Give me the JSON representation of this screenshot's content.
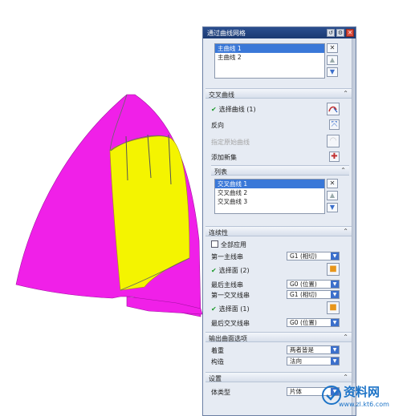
{
  "dialog": {
    "title": "通过曲线网格",
    "title_buttons": [
      "reset-icon",
      "gear-icon",
      "close-icon"
    ],
    "primary_list": {
      "items": [
        {
          "label": "主曲线 1",
          "selected": true
        },
        {
          "label": "主曲线 2",
          "selected": false
        }
      ]
    },
    "cross_section": {
      "header": "交叉曲线",
      "select_curve": "选择曲线 (1)",
      "reverse": "反向",
      "specify_origin": "指定原始曲线",
      "add_new": "添加新集",
      "list_header": "列表",
      "items": [
        {
          "label": "交叉曲线 1",
          "selected": true
        },
        {
          "label": "交叉曲线 2",
          "selected": false
        },
        {
          "label": "交叉曲线 3",
          "selected": false
        }
      ]
    },
    "continuity": {
      "header": "连续性",
      "apply_all": "全部应用",
      "first_primary": "第一主线串",
      "first_primary_value": "G1 (相切)",
      "select_face_1": "选择面 (2)",
      "last_primary": "最后主线串",
      "last_primary_value": "G0 (位置)",
      "first_cross": "第一交叉线串",
      "first_cross_value": "G1 (相切)",
      "select_face_2": "选择面 (1)",
      "last_cross": "最后交叉线串",
      "last_cross_value": "G0 (位置)"
    },
    "output": {
      "header": "输出曲面选项",
      "emphasis": "着重",
      "emphasis_value": "两者皆是",
      "constraint": "构造",
      "constraint_value": "法向"
    },
    "settings": {
      "header": "设置",
      "body_type": "体类型",
      "body_type_value": "片体"
    }
  },
  "watermark": {
    "name": "资料网",
    "url": "www.zl.kt6.com"
  },
  "colors": {
    "magenta_surface": "#f020e8",
    "yellow_surface": "#f4f400",
    "selection_blue": "#3a78d8",
    "title_blue": "#1b3a72"
  }
}
